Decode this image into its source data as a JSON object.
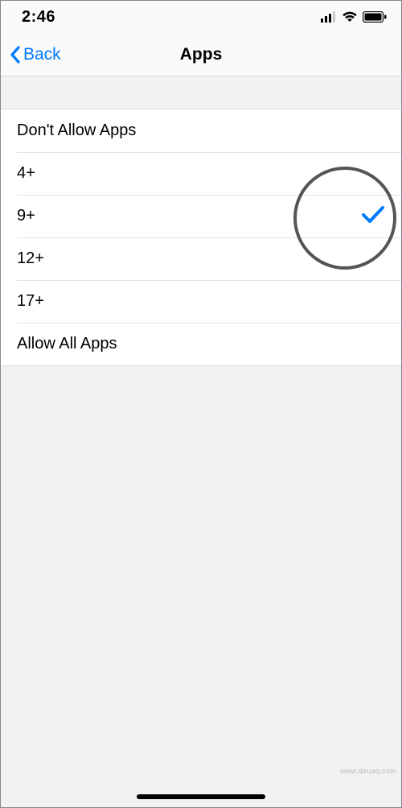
{
  "status": {
    "time": "2:46"
  },
  "nav": {
    "back_label": "Back",
    "title": "Apps"
  },
  "options": [
    {
      "label": "Don't Allow Apps",
      "selected": false
    },
    {
      "label": "4+",
      "selected": false
    },
    {
      "label": "9+",
      "selected": true
    },
    {
      "label": "12+",
      "selected": false
    },
    {
      "label": "17+",
      "selected": false
    },
    {
      "label": "Allow All Apps",
      "selected": false
    }
  ],
  "watermark": "www.deuaq.com"
}
